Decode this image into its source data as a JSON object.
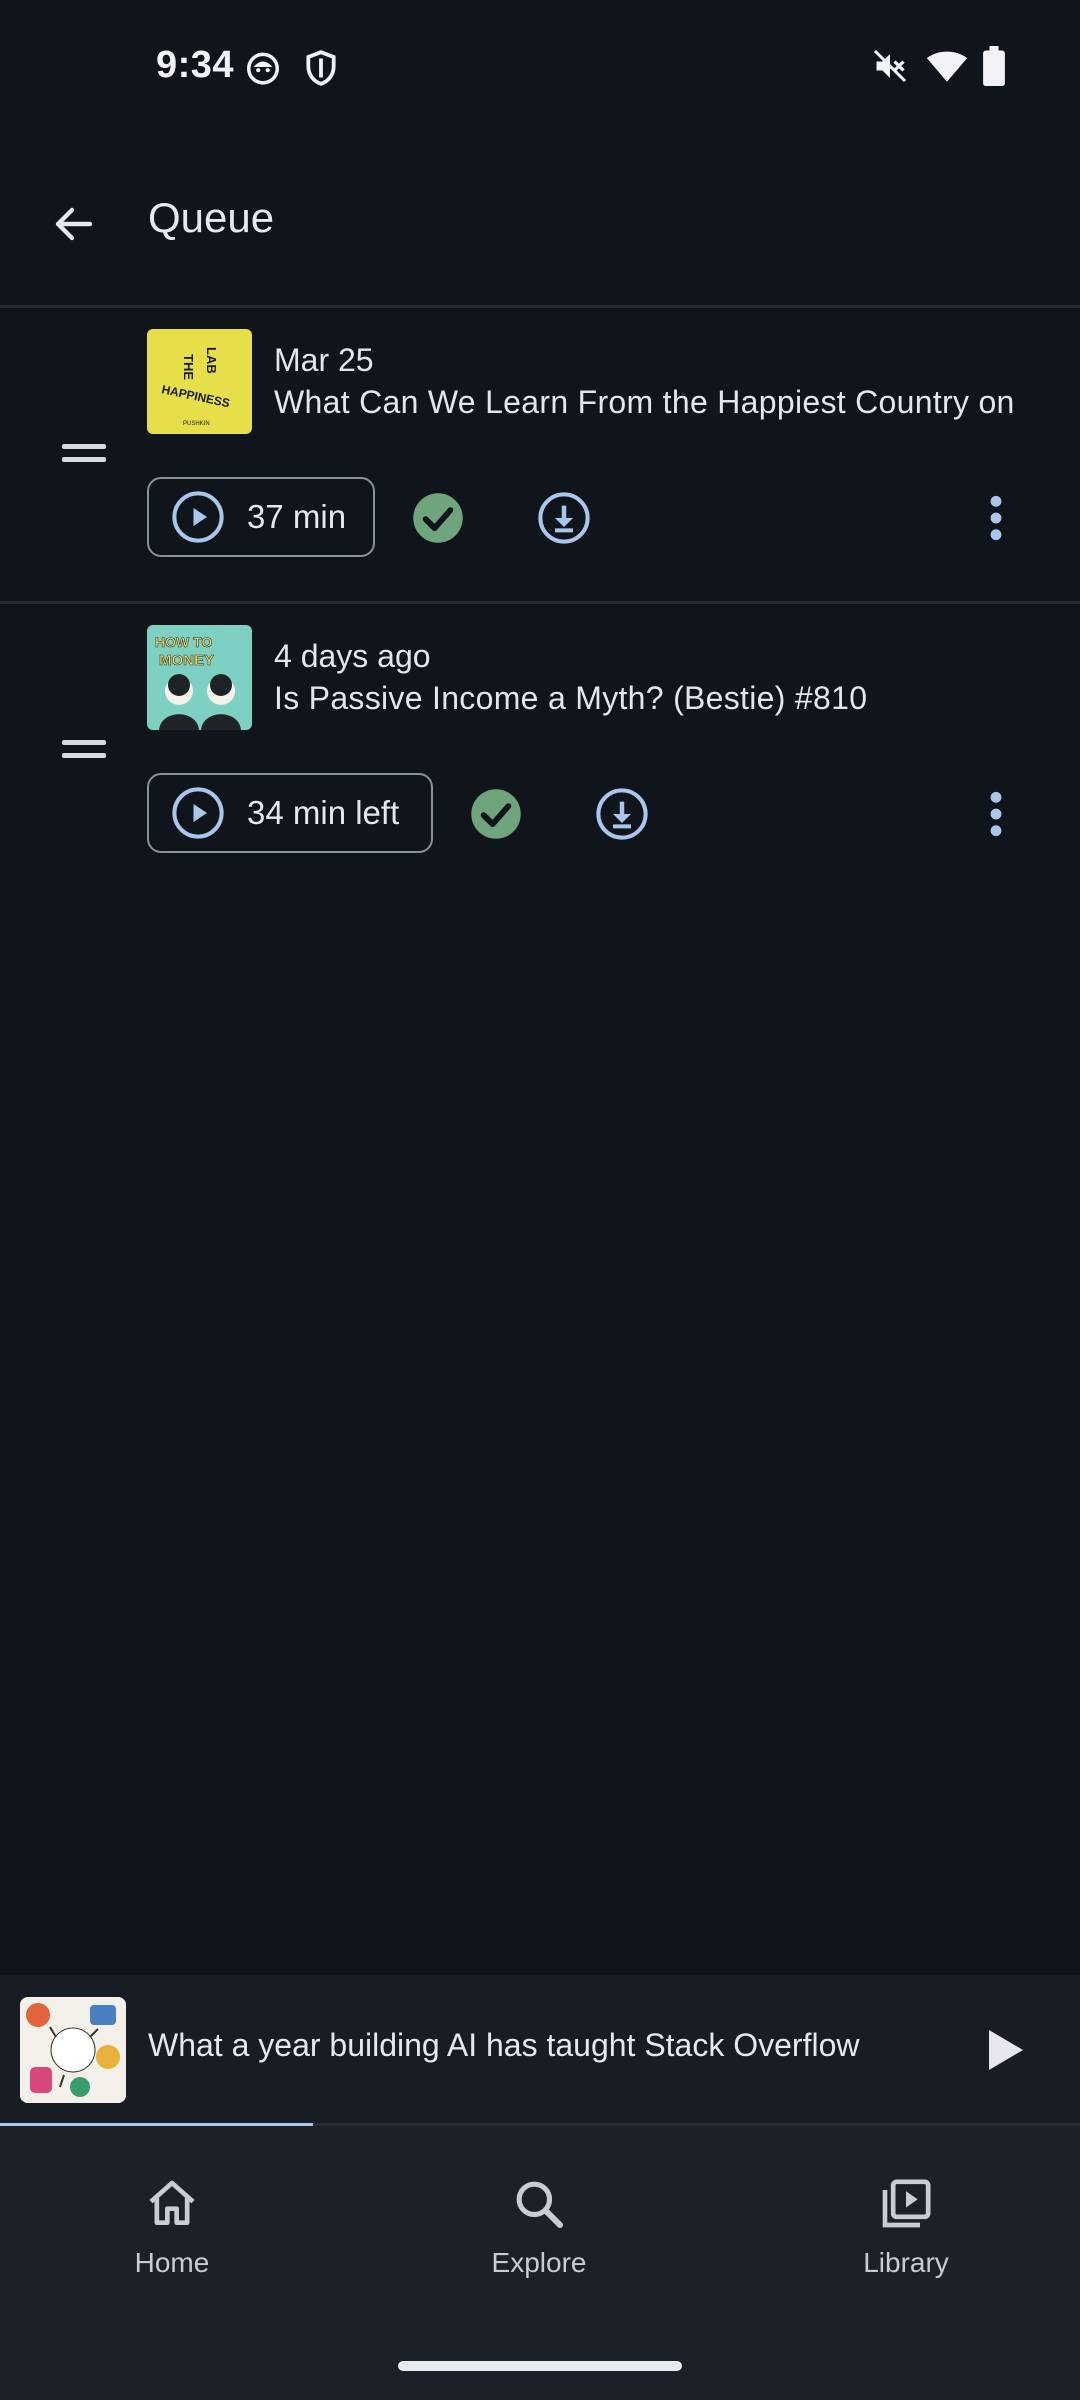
{
  "status_bar": {
    "time": "9:34",
    "icons": [
      "cat-face-icon",
      "shield-icon",
      "mute-icon",
      "wifi-icon",
      "battery-icon"
    ]
  },
  "app_bar": {
    "title": "Queue",
    "back_icon": "arrow-left-icon"
  },
  "queue": {
    "items": [
      {
        "date": "Mar 25",
        "title": "What Can We Learn From the Happiest Country on",
        "duration_label": "37 min",
        "artwork": {
          "line1": "THE",
          "line2": "LAB",
          "line3": "HAPPINESS",
          "line4": "PUSHKIN",
          "bg": "#e6df4a"
        }
      },
      {
        "date": "4 days ago",
        "title": "Is Passive Income a Myth? (Bestie) #810",
        "duration_label": "34 min left",
        "artwork": {
          "line1": "HOW TO",
          "line2": "MONEY",
          "bg": "#7dd0c2"
        }
      }
    ]
  },
  "mini_player": {
    "title": "What a year building AI has taught Stack Overflow",
    "progress": 0.29
  },
  "bottom_nav": {
    "items": [
      {
        "label": "Home",
        "icon": "home-icon"
      },
      {
        "label": "Explore",
        "icon": "search-icon"
      },
      {
        "label": "Library",
        "icon": "library-icon"
      }
    ]
  },
  "colors": {
    "background": "#10141b",
    "accent_blue": "#a9c7ec",
    "done_green": "#6fa57c",
    "nav_bg": "#1b2029"
  }
}
